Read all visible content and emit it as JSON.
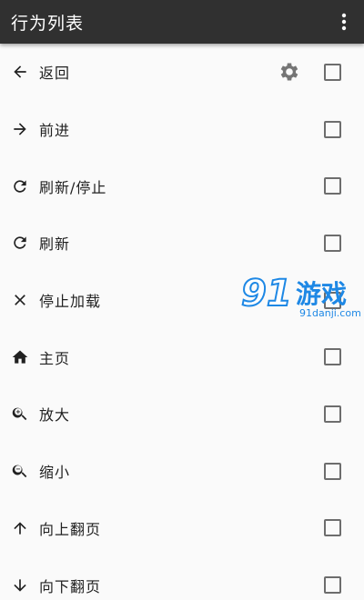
{
  "appbar": {
    "title": "行为列表",
    "overflow_icon": "more-vert-icon"
  },
  "items": [
    {
      "label": "返回",
      "icon": "arrow-left-icon",
      "has_settings": true,
      "checked": false
    },
    {
      "label": "前进",
      "icon": "arrow-right-icon",
      "checked": false
    },
    {
      "label": "刷新/停止",
      "icon": "refresh-icon",
      "checked": false
    },
    {
      "label": "刷新",
      "icon": "refresh-icon",
      "checked": false
    },
    {
      "label": "停止加载",
      "icon": "close-icon",
      "checked": false
    },
    {
      "label": "主页",
      "icon": "home-icon",
      "checked": false
    },
    {
      "label": "放大",
      "icon": "zoom-in-icon",
      "checked": false
    },
    {
      "label": "缩小",
      "icon": "zoom-out-icon",
      "checked": false
    },
    {
      "label": "向上翻页",
      "icon": "arrow-up-icon",
      "checked": false
    },
    {
      "label": "向下翻页",
      "icon": "arrow-down-icon",
      "checked": false
    }
  ],
  "watermark": {
    "logo": "91",
    "title": "游戏",
    "url": "91danji.com"
  },
  "colors": {
    "appbar_bg": "#303030",
    "page_bg": "#fafafa",
    "icon": "#212121",
    "checkbox_border": "#6d6d6d",
    "watermark": "#1e88e5"
  }
}
